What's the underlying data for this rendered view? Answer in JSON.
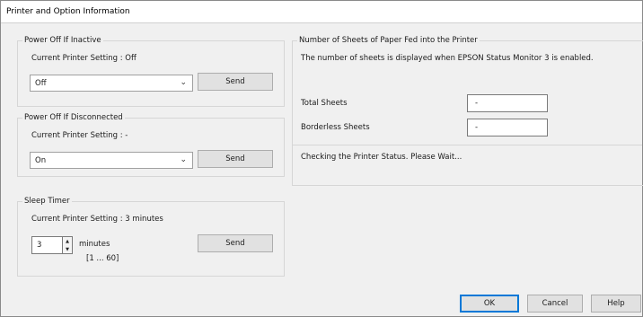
{
  "window": {
    "title": "Printer and Option Information"
  },
  "power_off_inactive": {
    "group_title": "Power Off If Inactive",
    "current_setting": "Current Printer Setting : Off",
    "selected": "Off",
    "send_label": "Send"
  },
  "power_off_disconnected": {
    "group_title": "Power Off If Disconnected",
    "current_setting": "Current Printer Setting : -",
    "selected": "On",
    "send_label": "Send"
  },
  "sleep_timer": {
    "group_title": "Sleep Timer",
    "current_setting": "Current Printer Setting : 3 minutes",
    "value": "3",
    "unit": "minutes",
    "range": "[1 ... 60]",
    "send_label": "Send"
  },
  "sheets": {
    "group_title": "Number of Sheets of Paper Fed into the Printer",
    "description": "The number of sheets is displayed when EPSON Status Monitor 3 is enabled.",
    "total_label": "Total Sheets",
    "total_value": "-",
    "borderless_label": "Borderless Sheets",
    "borderless_value": "-",
    "status_text": "Checking the Printer Status. Please Wait..."
  },
  "footer": {
    "ok_label": "OK",
    "cancel_label": "Cancel",
    "help_label": "Help"
  },
  "icons": {
    "dropdown": "chevron-down-icon",
    "spin_up": "spin-up-icon",
    "spin_down": "spin-down-icon"
  }
}
